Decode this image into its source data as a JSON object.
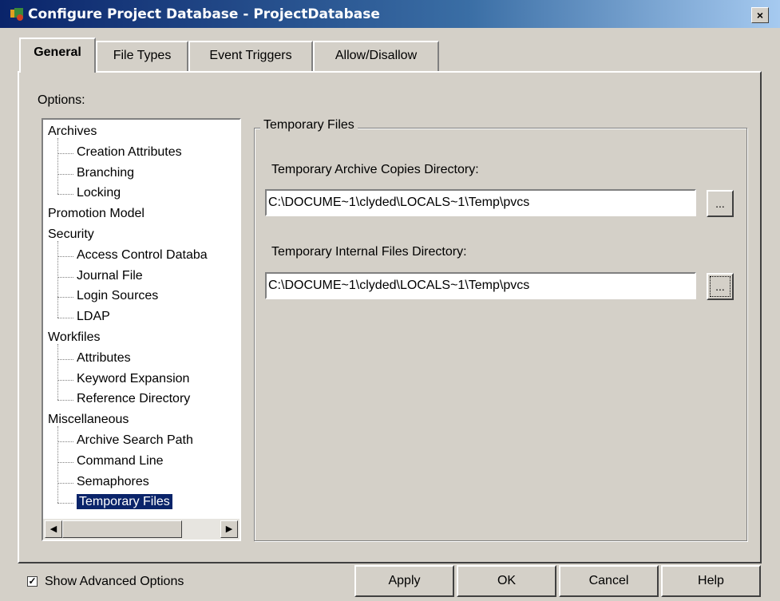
{
  "window": {
    "title": "Configure Project Database - ProjectDatabase",
    "close_label": "×"
  },
  "tabs": [
    {
      "label": "General",
      "active": true
    },
    {
      "label": "File Types",
      "active": false
    },
    {
      "label": "Event Triggers",
      "active": false
    },
    {
      "label": "Allow/Disallow",
      "active": false
    }
  ],
  "options": {
    "label": "Options:",
    "tree": [
      {
        "label": "Archives",
        "level": 0
      },
      {
        "label": "Creation Attributes",
        "level": 1
      },
      {
        "label": "Branching",
        "level": 1
      },
      {
        "label": "Locking",
        "level": 1
      },
      {
        "label": "Promotion Model",
        "level": 0
      },
      {
        "label": "Security",
        "level": 0
      },
      {
        "label": "Access Control Databa",
        "level": 1
      },
      {
        "label": "Journal File",
        "level": 1
      },
      {
        "label": "Login Sources",
        "level": 1
      },
      {
        "label": "LDAP",
        "level": 1
      },
      {
        "label": "Workfiles",
        "level": 0
      },
      {
        "label": "Attributes",
        "level": 1
      },
      {
        "label": "Keyword Expansion",
        "level": 1
      },
      {
        "label": "Reference Directory",
        "level": 1
      },
      {
        "label": "Miscellaneous",
        "level": 0
      },
      {
        "label": "Archive Search Path",
        "level": 1
      },
      {
        "label": "Command Line",
        "level": 1
      },
      {
        "label": "Semaphores",
        "level": 1
      },
      {
        "label": "Temporary Files",
        "level": 1,
        "selected": true
      }
    ],
    "scroll_left": "◀",
    "scroll_right": "▶"
  },
  "temporary_files": {
    "legend": "Temporary Files",
    "archive_copies_label": "Temporary Archive Copies Directory:",
    "archive_copies_value": "C:\\DOCUME~1\\clyded\\LOCALS~1\\Temp\\pvcs",
    "internal_files_label": "Temporary Internal Files Directory:",
    "internal_files_value": "C:\\DOCUME~1\\clyded\\LOCALS~1\\Temp\\pvcs",
    "browse_label": "..."
  },
  "footer": {
    "show_advanced_label": "Show Advanced Options",
    "show_advanced_checked": true,
    "check_mark": "✓",
    "apply_label": "Apply",
    "ok_label": "OK",
    "cancel_label": "Cancel",
    "help_label": "Help"
  }
}
